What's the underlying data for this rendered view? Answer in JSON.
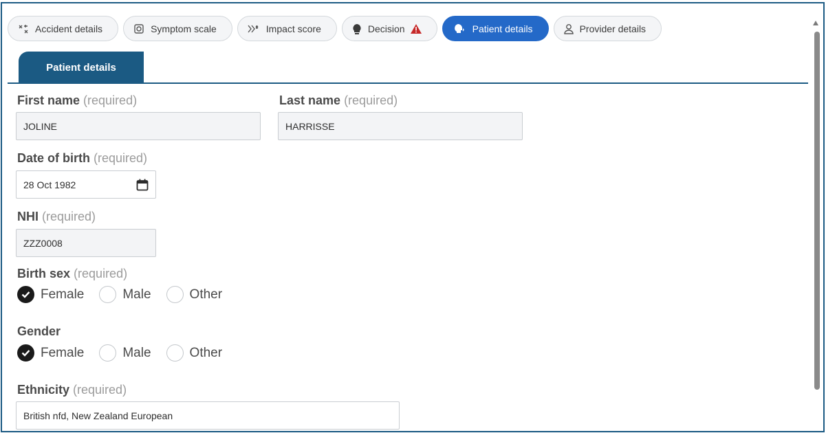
{
  "top_tabs": [
    {
      "label": "Accident details",
      "icon": "accident-icon"
    },
    {
      "label": "Symptom scale",
      "icon": "scale-icon"
    },
    {
      "label": "Impact score",
      "icon": "impact-icon"
    },
    {
      "label": "Decision",
      "icon": "lightbulb-icon",
      "warning_icon": "warning-triangle-icon"
    },
    {
      "label": "Patient details",
      "icon": "patient-head-icon",
      "active": true
    },
    {
      "label": "Provider details",
      "icon": "person-icon"
    }
  ],
  "section": {
    "title": "Patient details"
  },
  "form": {
    "required_text": "(required)",
    "first_name": {
      "label": "First name",
      "value": "JOLINE"
    },
    "last_name": {
      "label": "Last name",
      "value": "HARRISSE"
    },
    "dob": {
      "label": "Date of birth",
      "value": "28 Oct 1982",
      "icon": "calendar-icon"
    },
    "nhi": {
      "label": "NHI",
      "value": "ZZZ0008"
    },
    "birth_sex": {
      "label": "Birth sex",
      "options": [
        "Female",
        "Male",
        "Other"
      ],
      "selected": "Female"
    },
    "gender": {
      "label": "Gender",
      "options": [
        "Female",
        "Male",
        "Other"
      ],
      "selected": "Female"
    },
    "ethnicity": {
      "label": "Ethnicity",
      "value": "British nfd, New Zealand European"
    }
  },
  "colors": {
    "accent": "#2469c8",
    "section": "#1b5a83",
    "warning": "#c62828"
  }
}
